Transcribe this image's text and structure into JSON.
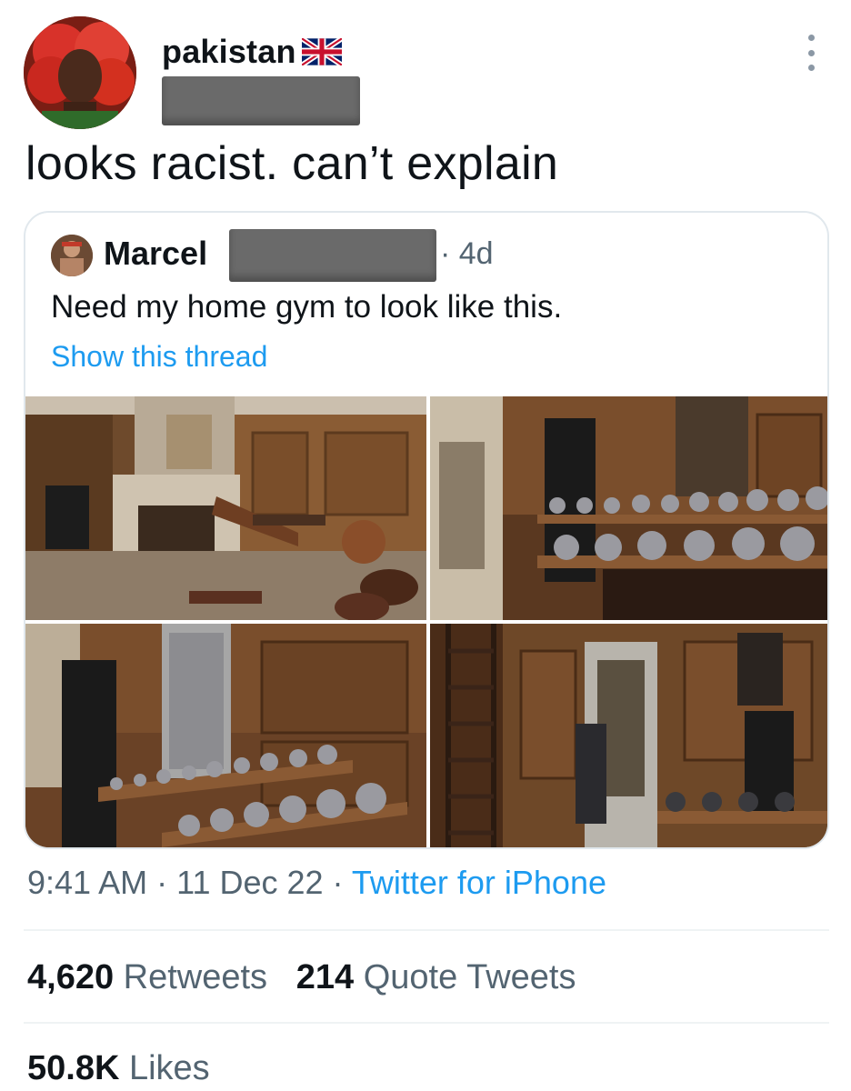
{
  "tweet": {
    "display_name": "pakistan",
    "flag_icon": "uk-flag-icon",
    "handle_redacted": true,
    "text": "looks racist. can’t explain",
    "menu_icon": "more-vertical-icon"
  },
  "quoted_tweet": {
    "display_name": "Marcel",
    "time": "· 4d",
    "text": "Need my home gym to look like this.",
    "show_thread": "Show this thread",
    "media": [
      {
        "alt": "wood-paneled home gym with fireplace, bench and dumbbells"
      },
      {
        "alt": "dumbbell rack by fireplace"
      },
      {
        "alt": "dumbbell rack with mirror and pedestal"
      },
      {
        "alt": "wall ladder, mirror and kettlebells"
      }
    ]
  },
  "meta": {
    "time": "9:41 AM",
    "sep1": " · ",
    "date": "11 Dec 22",
    "sep2": " · ",
    "source": "Twitter for iPhone"
  },
  "stats": {
    "retweets_count": "4,620",
    "retweets_label": "Retweets",
    "quotes_count": "214",
    "quotes_label": "Quote Tweets",
    "likes_count": "50.8K",
    "likes_label": "Likes"
  },
  "colors": {
    "accent": "#1d9bf0",
    "muted": "#536471",
    "text": "#0f1419"
  }
}
